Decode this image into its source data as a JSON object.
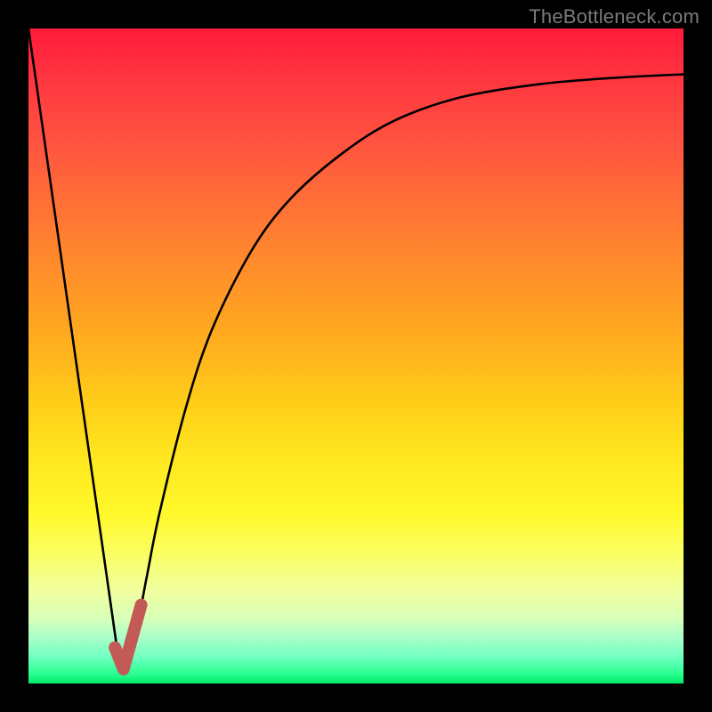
{
  "watermark": "TheBottleneck.com",
  "chart_data": {
    "type": "line",
    "title": "",
    "xlabel": "",
    "ylabel": "",
    "xlim": [
      0,
      100
    ],
    "ylim": [
      0,
      100
    ],
    "series": [
      {
        "name": "left-descent",
        "x": [
          0,
          14
        ],
        "values": [
          100,
          2
        ]
      },
      {
        "name": "right-curve",
        "x": [
          14,
          16,
          18,
          20,
          24,
          28,
          34,
          40,
          48,
          56,
          66,
          78,
          90,
          100
        ],
        "values": [
          2,
          6,
          16,
          26,
          42,
          54,
          66,
          74,
          81,
          86,
          89.5,
          91.5,
          92.5,
          93
        ]
      }
    ],
    "marker": {
      "name": "highlight-segment",
      "color": "#c45a56",
      "x": [
        13.2,
        14.5,
        17.2
      ],
      "values": [
        5.5,
        2.2,
        12
      ]
    }
  },
  "colors": {
    "curve": "#000000",
    "marker": "#c45a56",
    "background_top": "#ff1a3a",
    "background_bottom": "#00e868",
    "frame": "#000000"
  }
}
